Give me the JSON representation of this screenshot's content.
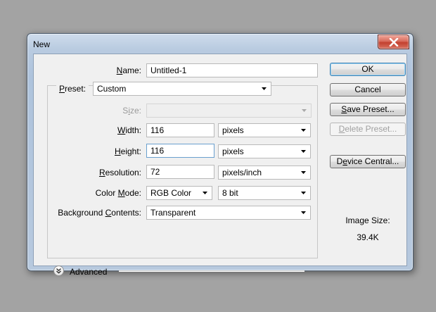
{
  "window": {
    "title": "New"
  },
  "fields": {
    "name": {
      "label_u": "N",
      "label_rest": "ame:",
      "value": "Untitled-1"
    },
    "preset": {
      "label_u": "P",
      "label_rest": "reset:",
      "value": "Custom"
    },
    "size": {
      "label_pre": "S",
      "label_u": "i",
      "label_rest": "ze:",
      "value": ""
    },
    "width": {
      "label_u": "W",
      "label_rest": "idth:",
      "value": "116",
      "unit": "pixels"
    },
    "height": {
      "label_u": "H",
      "label_rest": "eight:",
      "value": "116",
      "unit": "pixels"
    },
    "resolution": {
      "label_u": "R",
      "label_rest": "esolution:",
      "value": "72",
      "unit": "pixels/inch"
    },
    "color_mode": {
      "label_pre": "Color ",
      "label_u": "M",
      "label_rest": "ode:",
      "value": "RGB Color",
      "depth": "8 bit"
    },
    "background": {
      "label_pre": "Background ",
      "label_u": "C",
      "label_rest": "ontents:",
      "value": "Transparent"
    }
  },
  "advanced_label": "Advanced",
  "buttons": {
    "ok": "OK",
    "cancel": "Cancel",
    "save_preset": {
      "u": "S",
      "rest": "ave Preset..."
    },
    "delete_preset": {
      "u": "D",
      "rest": "elete Preset..."
    },
    "device_central": {
      "u": "e",
      "pre": "D",
      "rest": "vice Central..."
    }
  },
  "image_size": {
    "label": "Image Size:",
    "value": "39.4K"
  }
}
